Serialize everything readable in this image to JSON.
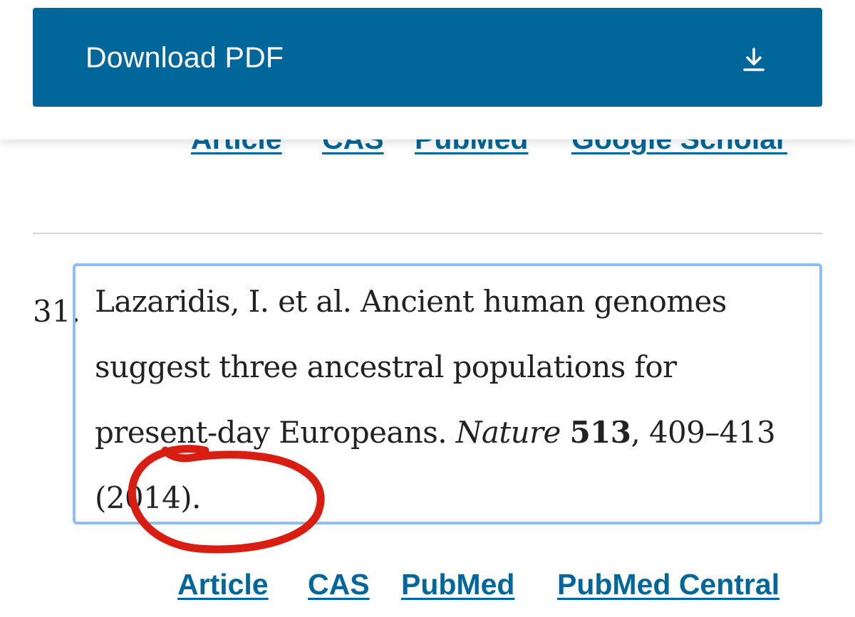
{
  "download": {
    "label": "Download PDF",
    "icon": "download-icon"
  },
  "previous_reference": {
    "links": [
      "Article",
      "CAS",
      "PubMed",
      "Google Scholar"
    ]
  },
  "reference": {
    "number": "31.",
    "authors": "Lazaridis, I. et al.",
    "title": "Ancient human genomes suggest three ancestral populations for present-day Europeans.",
    "journal": "Nature",
    "volume": "513",
    "pages": ", 409–413",
    "year": " (2014).",
    "links": [
      "Article",
      "CAS",
      "PubMed",
      "PubMed Central"
    ]
  },
  "colors": {
    "brand_blue": "#01669a",
    "highlight_border": "#8ebef1",
    "annotation_red": "#d81e12"
  }
}
